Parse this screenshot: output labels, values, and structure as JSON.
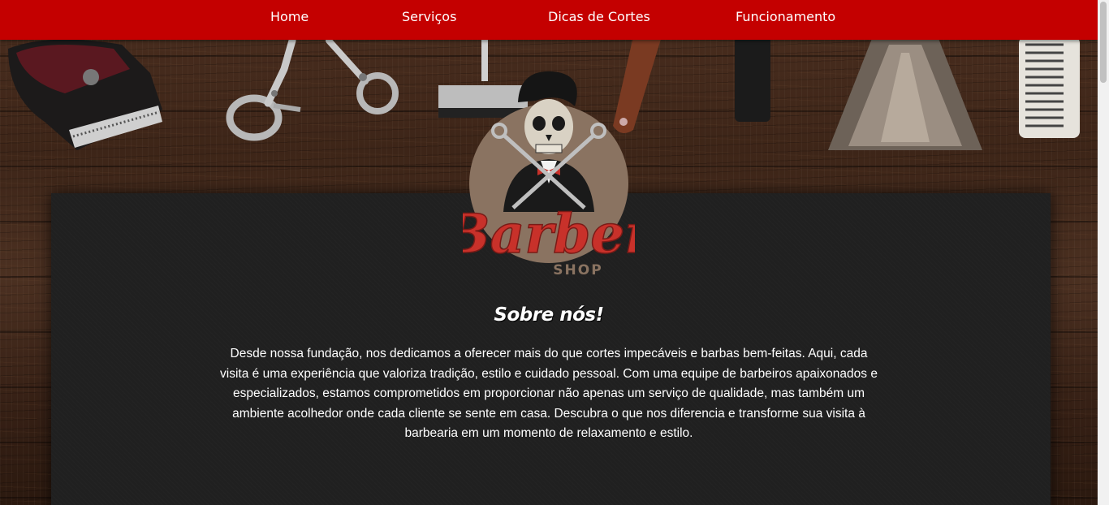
{
  "nav": {
    "items": [
      {
        "label": "Home"
      },
      {
        "label": "Serviços"
      },
      {
        "label": "Dicas de Cortes"
      },
      {
        "label": "Funcionamento"
      }
    ]
  },
  "logo": {
    "text_main": "Barber",
    "text_sub": "SHOP"
  },
  "about": {
    "title": "Sobre nós!",
    "description": "Desde nossa fundação, nos dedicamos a oferecer mais do que cortes impecáveis e barbas bem-feitas. Aqui, cada visita é uma experiência que valoriza tradição, estilo e cuidado pessoal. Com uma equipe de barbeiros apaixonados e especializados, estamos comprometidos em proporcionar não apenas um serviço de qualidade, mas também um ambiente acolhedor onde cada cliente se sente em casa. Descubra o que nos diferencia e transforme sua visita à barbearia em um momento de relaxamento e estilo."
  },
  "colors": {
    "nav_bg": "#c40000",
    "card_bg": "#202020",
    "text": "#ffffff",
    "logo_red": "#c8312a",
    "logo_tan": "#8a7361"
  }
}
